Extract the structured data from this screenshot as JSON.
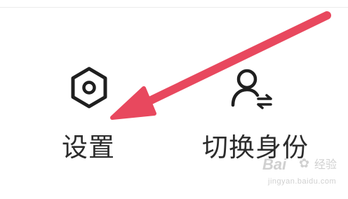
{
  "menu": {
    "settings": {
      "label": "设置",
      "icon": "settings-icon"
    },
    "switch_identity": {
      "label": "切换身份",
      "icon": "switch-user-icon"
    }
  },
  "annotation": {
    "arrow_color": "#e8485e",
    "points_to": "settings"
  },
  "watermark": {
    "logo": "Bai",
    "suffix": "经验",
    "url": "jingyan.baidu.com"
  },
  "colors": {
    "text": "#2c2c2c",
    "icon": "#1f1f1f",
    "background": "#ffffff"
  }
}
